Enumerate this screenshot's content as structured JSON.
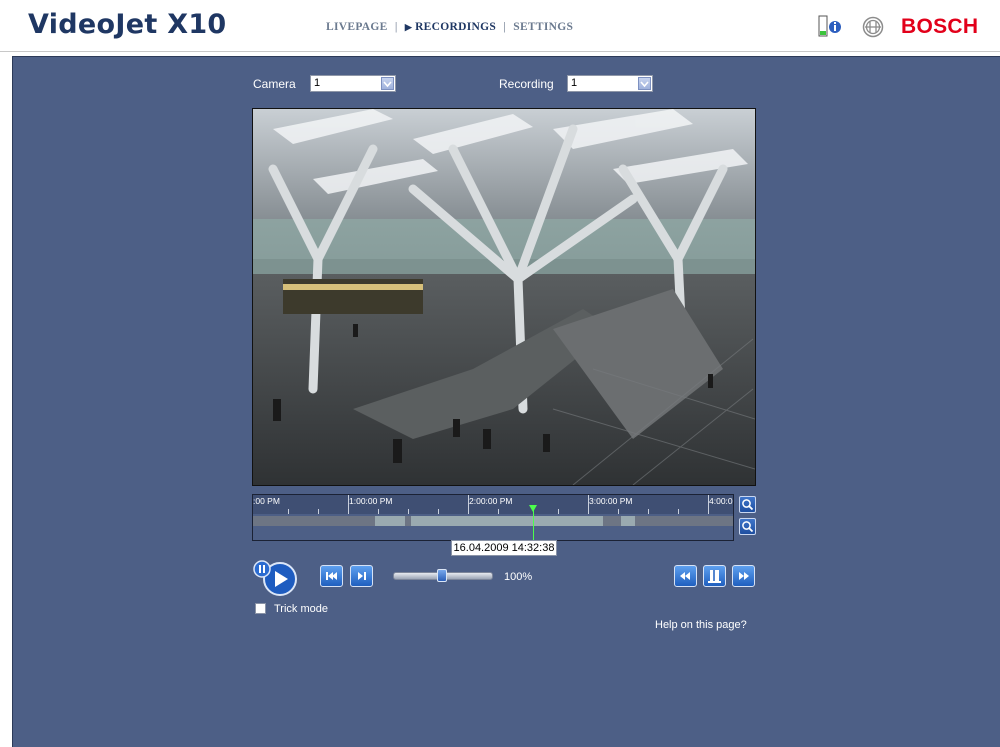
{
  "header": {
    "title": "VideoJet X10",
    "nav": [
      {
        "label": "LIVEPAGE",
        "active": false
      },
      {
        "label": "RECORDINGS",
        "active": true
      },
      {
        "label": "SETTINGS",
        "active": false
      }
    ],
    "separator": "|",
    "status_icon": "status-info-icon",
    "brand": "BOSCH",
    "brand_color": "#e2001a"
  },
  "filters": {
    "camera_label": "Camera",
    "camera_value": "1",
    "recording_label": "Recording",
    "recording_value": "1"
  },
  "timeline": {
    "tick_labels": [
      ":00 PM",
      "1:00:00 PM",
      "2:00:00 PM",
      "3:00:00 PM",
      "4:00:0"
    ],
    "current_datetime": "16.04.2009 14:32:38"
  },
  "controls": {
    "play_icon": "play-pause-icon",
    "skip_back_icon": "jump-to-start-icon",
    "step_forward_icon": "step-forward-icon",
    "speed": "100%",
    "rewind_icon": "rewind-icon",
    "export_icon": "export-icon",
    "fast_forward_icon": "fast-forward-icon",
    "trick_mode_label": "Trick mode",
    "trick_mode_checked": false
  },
  "help_link": "Help on this page?",
  "colors": {
    "background": "#4d5f86",
    "title": "#1f3763",
    "accent_blue": "#2d6bd0",
    "timeline_cursor": "#4cff4c"
  }
}
